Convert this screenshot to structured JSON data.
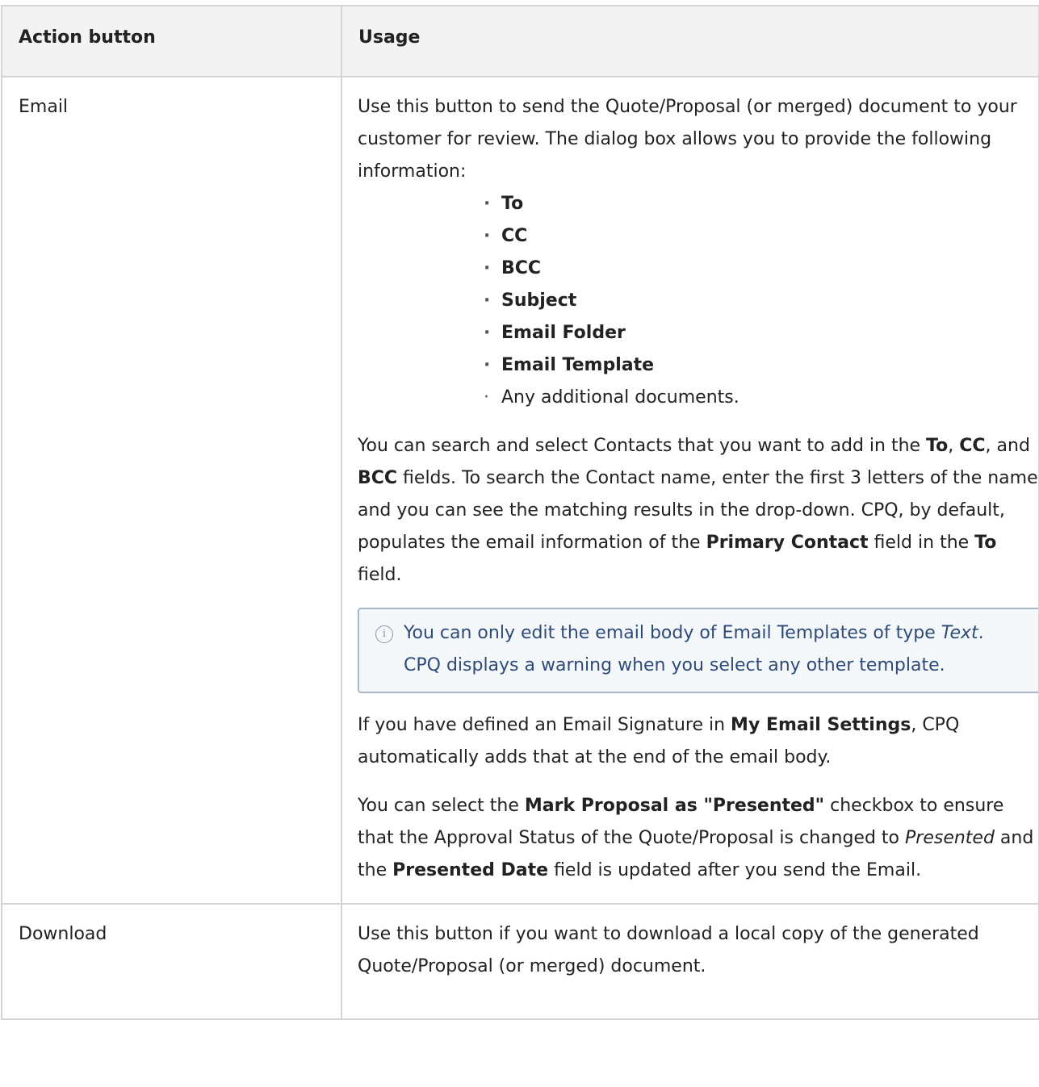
{
  "table": {
    "headers": {
      "action": "Action button",
      "usage": "Usage"
    },
    "rows": {
      "email": {
        "action": "Email",
        "intro": "Use this button to send the Quote/Proposal (or merged) document to your customer for review. The dialog box allows you to provide the following information:",
        "options": [
          "To",
          "CC",
          "BCC",
          "Subject",
          "Email Folder",
          "Email Template",
          "Any additional documents."
        ],
        "search": {
          "t1": "You can search and select Contacts that you want to add in the ",
          "to": "To",
          "t2": ", ",
          "cc": "CC",
          "t3": ", and ",
          "bcc": "BCC",
          "t4": " fields. To search the Contact name, enter the first 3 letters of the name and you can see the matching results in the drop-down. CPQ, by default, populates the email information of the ",
          "primary": "Primary Contact",
          "t5": " field in the ",
          "to2": "To",
          "t6": " field."
        },
        "note": {
          "icon": "info-icon",
          "t1": "You can only edit the email body of Email Templates of type ",
          "em": "Text",
          "t2": ". CPQ displays a warning when you select any other template."
        },
        "signature": {
          "t1": "If you have defined an Email Signature in ",
          "settings": "My Email Settings",
          "t2": ", CPQ automatically adds that at the end of the email body."
        },
        "mark": {
          "t1": "You can select the ",
          "checkbox": "Mark Proposal as \"Presented\"",
          "t2": " checkbox to ensure that the Approval Status of the Quote/Proposal is changed to ",
          "presented": "Presented",
          "t3": " and the ",
          "date": "Presented Date",
          "t4": " field is updated after you send the Email."
        }
      },
      "download": {
        "action": "Download",
        "usage": "Use this button if you want to download a local copy of the generated Quote/Proposal (or merged) document."
      }
    }
  }
}
